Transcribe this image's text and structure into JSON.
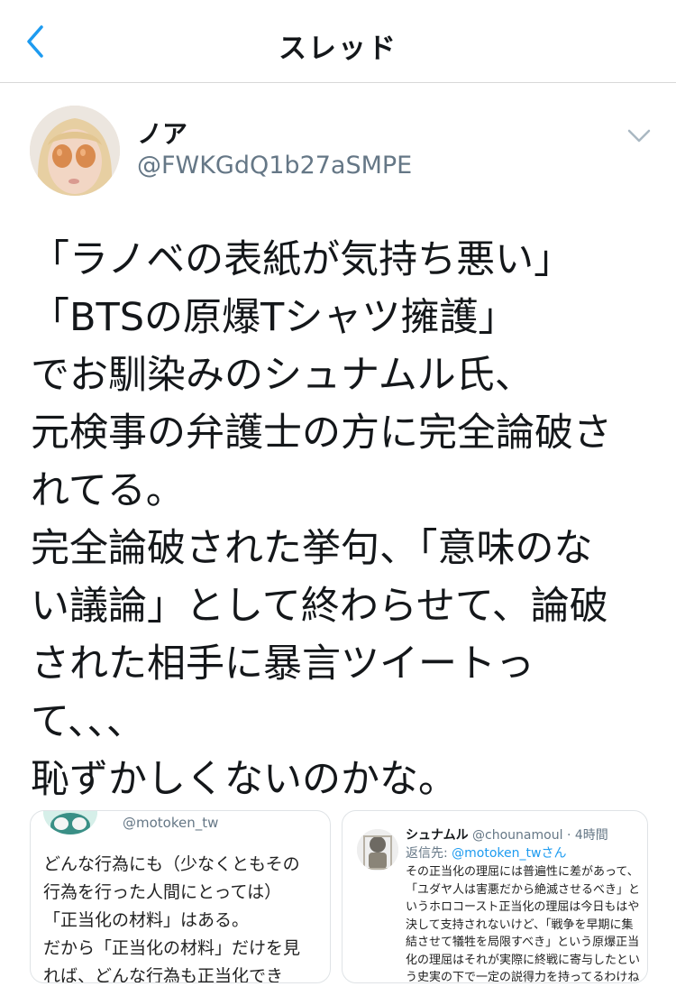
{
  "nav": {
    "title": "スレッド",
    "back_icon": "chevron-left-icon",
    "accent": "#1d9bf0"
  },
  "author": {
    "name": "ノア",
    "handle": "@FWKGdQ1b27aSMPE",
    "menu_icon": "chevron-down-icon"
  },
  "tweet": {
    "lines": [
      "「ラノベの表紙が気持ち悪い」",
      "「BTSの原爆Tシャツ擁護」",
      "でお馴染みのシュナムル氏、",
      "元検事の弁護士の方に完全論破さ",
      "れてる。",
      "完全論破された挙句、「意味のな",
      "い議論」として終わらせて、論破",
      "された相手に暴言ツイートっ",
      "て、、、",
      "恥ずかしくないのかな。"
    ]
  },
  "media_left": {
    "handle": "@motoken_tw",
    "lines": [
      "どんな行為にも（少なくともその",
      "行為を行った人間にとっては）",
      "「正当化の材料」はある。",
      "だから「正当化の材料」だけを見",
      "れば、どんな行為も正当化でき"
    ]
  },
  "media_right": {
    "name": "シュナムル",
    "handle": "@chounamoul",
    "time": "· 4時間",
    "reply_prefix": "返信先:",
    "reply_to": "@motoken_twさん",
    "lines": [
      "その正当化の理屈には普遍性に差があって、",
      "「ユダヤ人は害悪だから絶滅させるべき」と",
      "いうホロコースト正当化の理屈は今日もはや",
      "決して支持されないけど、「戦争を早期に集",
      "結させて犠牲を局限すべき」という原爆正当",
      "化の理屈はそれが実際に終戦に寄与したとい",
      "う史実の下で一定の説得力を持ってるわけね"
    ]
  }
}
